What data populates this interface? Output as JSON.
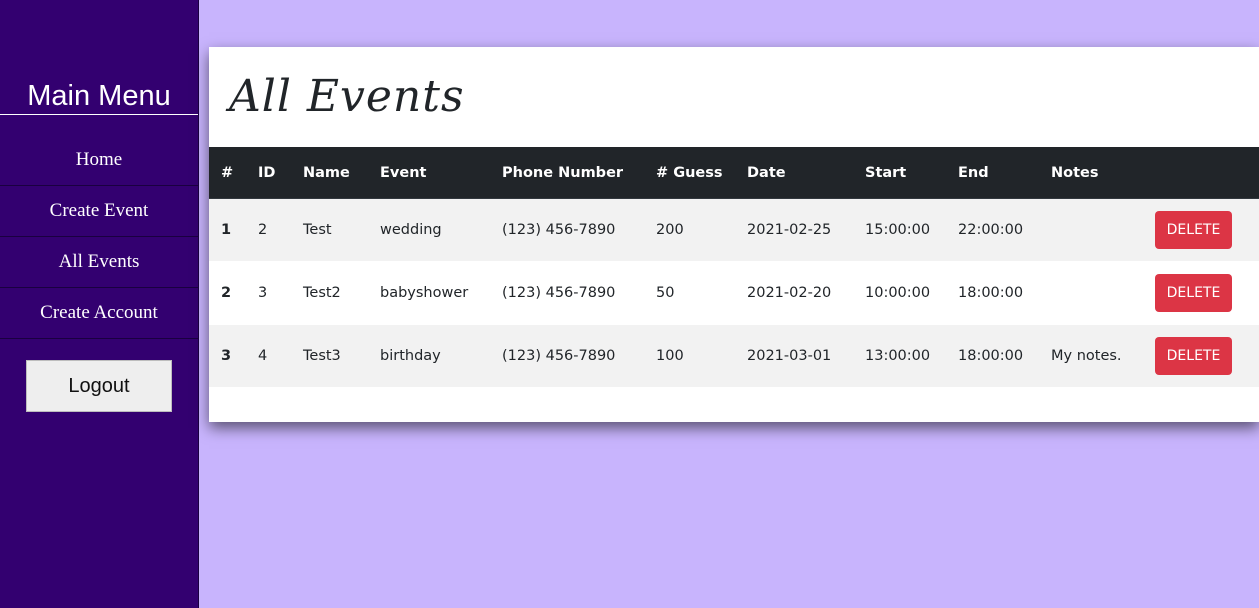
{
  "sidebar": {
    "title": "Main Menu",
    "items": [
      {
        "label": "Home"
      },
      {
        "label": "Create Event"
      },
      {
        "label": "All Events"
      },
      {
        "label": "Create Account"
      }
    ],
    "logout_label": "Logout",
    "background": "#330070"
  },
  "page": {
    "background": "#c8b4fd",
    "title": "All Events"
  },
  "table": {
    "headers": [
      "#",
      "ID",
      "Name",
      "Event",
      "Phone Number",
      "# Guess",
      "Date",
      "Start",
      "End",
      "Notes"
    ],
    "rows": [
      {
        "num": "1",
        "id": "2",
        "name": "Test",
        "event": "wedding",
        "phone": "(123) 456-7890",
        "guests": "200",
        "date": "2021-02-25",
        "start": "15:00:00",
        "end": "22:00:00",
        "notes": "",
        "action": "DELETE"
      },
      {
        "num": "2",
        "id": "3",
        "name": "Test2",
        "event": "babyshower",
        "phone": "(123) 456-7890",
        "guests": "50",
        "date": "2021-02-20",
        "start": "10:00:00",
        "end": "18:00:00",
        "notes": "",
        "action": "DELETE"
      },
      {
        "num": "3",
        "id": "4",
        "name": "Test3",
        "event": "birthday",
        "phone": "(123) 456-7890",
        "guests": "100",
        "date": "2021-03-01",
        "start": "13:00:00",
        "end": "18:00:00",
        "notes": "My notes.",
        "action": "DELETE"
      }
    ],
    "header_background": "#212529",
    "delete_color": "#dc3545"
  }
}
